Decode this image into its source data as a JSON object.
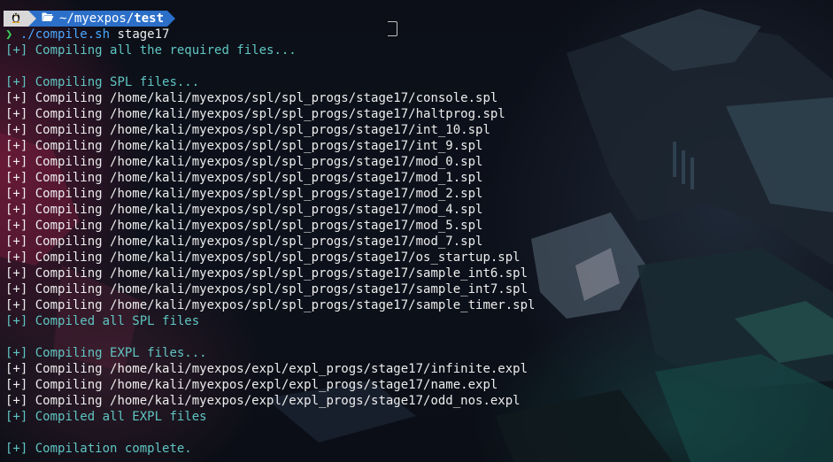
{
  "prompt": {
    "os_icon": "linux-penguin-icon",
    "folder_icon": "folder-open-icon",
    "path_prefix": "~/myexpos/",
    "path_current": "test",
    "symbol": "❯",
    "command_script": "./compile.sh",
    "command_arg": " stage17"
  },
  "colors": {
    "prompt_os_bg": "#d8d8d8",
    "prompt_path_bg": "#2b6fc9",
    "prompt_symbol": "#3bd15a",
    "command": "#4aa8ff",
    "info_text": "#5fc6c2",
    "plain_text": "#ededed"
  },
  "output": [
    {
      "tag": "[+]",
      "text": " Compiling all the required files...",
      "style": "info"
    },
    {
      "tag": "",
      "text": "",
      "style": "blank"
    },
    {
      "tag": "[+]",
      "text": " Compiling SPL files...",
      "style": "info"
    },
    {
      "tag": "[+]",
      "text": " Compiling /home/kali/myexpos/spl/spl_progs/stage17/console.spl",
      "style": "plain"
    },
    {
      "tag": "[+]",
      "text": " Compiling /home/kali/myexpos/spl/spl_progs/stage17/haltprog.spl",
      "style": "plain"
    },
    {
      "tag": "[+]",
      "text": " Compiling /home/kali/myexpos/spl/spl_progs/stage17/int_10.spl",
      "style": "plain"
    },
    {
      "tag": "[+]",
      "text": " Compiling /home/kali/myexpos/spl/spl_progs/stage17/int_9.spl",
      "style": "plain"
    },
    {
      "tag": "[+]",
      "text": " Compiling /home/kali/myexpos/spl/spl_progs/stage17/mod_0.spl",
      "style": "plain"
    },
    {
      "tag": "[+]",
      "text": " Compiling /home/kali/myexpos/spl/spl_progs/stage17/mod_1.spl",
      "style": "plain"
    },
    {
      "tag": "[+]",
      "text": " Compiling /home/kali/myexpos/spl/spl_progs/stage17/mod_2.spl",
      "style": "plain"
    },
    {
      "tag": "[+]",
      "text": " Compiling /home/kali/myexpos/spl/spl_progs/stage17/mod_4.spl",
      "style": "plain"
    },
    {
      "tag": "[+]",
      "text": " Compiling /home/kali/myexpos/spl/spl_progs/stage17/mod_5.spl",
      "style": "plain"
    },
    {
      "tag": "[+]",
      "text": " Compiling /home/kali/myexpos/spl/spl_progs/stage17/mod_7.spl",
      "style": "plain"
    },
    {
      "tag": "[+]",
      "text": " Compiling /home/kali/myexpos/spl/spl_progs/stage17/os_startup.spl",
      "style": "plain"
    },
    {
      "tag": "[+]",
      "text": " Compiling /home/kali/myexpos/spl/spl_progs/stage17/sample_int6.spl",
      "style": "plain"
    },
    {
      "tag": "[+]",
      "text": " Compiling /home/kali/myexpos/spl/spl_progs/stage17/sample_int7.spl",
      "style": "plain"
    },
    {
      "tag": "[+]",
      "text": " Compiling /home/kali/myexpos/spl/spl_progs/stage17/sample_timer.spl",
      "style": "plain"
    },
    {
      "tag": "[+]",
      "text": " Compiled all SPL files",
      "style": "info"
    },
    {
      "tag": "",
      "text": "",
      "style": "blank"
    },
    {
      "tag": "[+]",
      "text": " Compiling EXPL files...",
      "style": "info"
    },
    {
      "tag": "[+]",
      "text": " Compiling /home/kali/myexpos/expl/expl_progs/stage17/infinite.expl",
      "style": "plain"
    },
    {
      "tag": "[+]",
      "text": " Compiling /home/kali/myexpos/expl/expl_progs/stage17/name.expl",
      "style": "plain"
    },
    {
      "tag": "[+]",
      "text": " Compiling /home/kali/myexpos/expl/expl_progs/stage17/odd_nos.expl",
      "style": "plain"
    },
    {
      "tag": "[+]",
      "text": " Compiled all EXPL files",
      "style": "info"
    },
    {
      "tag": "",
      "text": "",
      "style": "blank"
    },
    {
      "tag": "[+]",
      "text": " Compilation complete.",
      "style": "info"
    }
  ]
}
